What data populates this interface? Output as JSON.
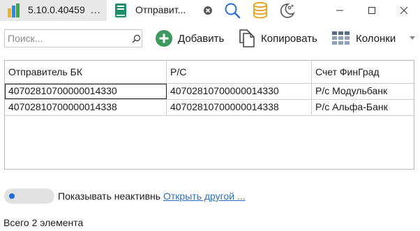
{
  "titlebar": {
    "app_version": "5.10.0.40459",
    "app_dots": "...",
    "doc_tab_title": "Отправит...",
    "icons": [
      "app-logo-icon",
      "book-icon",
      "close-icon",
      "search-icon",
      "database-icon",
      "theme-icon",
      "minimize-icon",
      "maximize-icon",
      "close-window-icon"
    ]
  },
  "toolbar": {
    "search_placeholder": "Поиск...",
    "search_value": "",
    "add_label": "Добавить",
    "copy_label": "Копировать",
    "columns_label": "Колонки"
  },
  "grid": {
    "columns": [
      "Отправитель БК",
      "Р/С",
      "Счет ФинГрад"
    ],
    "rows": [
      [
        "40702810700000014330",
        "40702810700000014330",
        "Р/с Модульбанк"
      ],
      [
        "40702810700000014338",
        "40702810700000014338",
        "Р/с Альфа-Банк"
      ]
    ]
  },
  "footer": {
    "toggle_label": "Показывать неактивные",
    "toggle_on": false,
    "open_link": "Открыть другой ...",
    "status": "Всего 2 элемента"
  },
  "colors": {
    "accent": "#1e6fd9",
    "add_icon": "#3d9a5f",
    "link": "#2a6fbd",
    "database_icon": "#e8a21a",
    "search_icon": "#2b6fd6",
    "app_tab_bg": "#e8e8e8"
  }
}
